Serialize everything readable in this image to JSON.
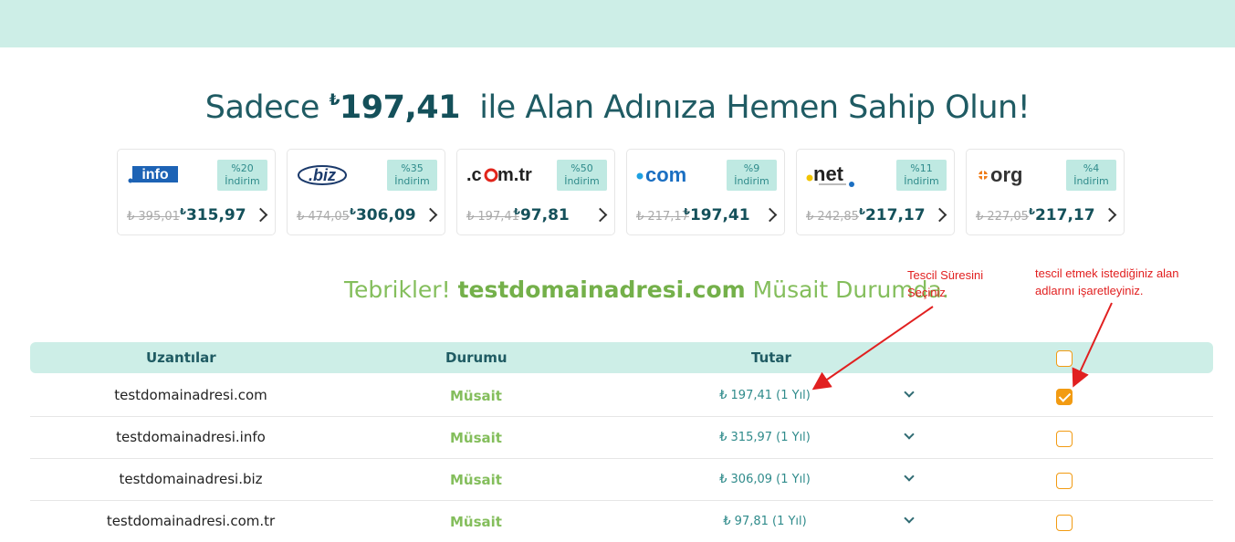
{
  "headline": {
    "prefix": "Sadece ",
    "currency": "₺",
    "price": "197,41",
    "suffix": "  ile Alan Adınıza Hemen Sahip Olun!"
  },
  "cards": [
    {
      "ext": ".info",
      "discount": "%20",
      "discount_label": "İndirim",
      "old_price": "₺ 395,01",
      "new_price": "315,97",
      "currency": "₺",
      "logo_icon": "info-logo-icon"
    },
    {
      "ext": ".biz",
      "discount": "%35",
      "discount_label": "İndirim",
      "old_price": "₺ 474,05",
      "new_price": "306,09",
      "currency": "₺",
      "logo_icon": "biz-logo-icon"
    },
    {
      "ext": ".com.tr",
      "discount": "%50",
      "discount_label": "İndirim",
      "old_price": "₺ 197,41",
      "new_price": "97,81",
      "currency": "₺",
      "logo_icon": "comtr-logo-icon"
    },
    {
      "ext": ".com",
      "discount": "%9",
      "discount_label": "İndirim",
      "old_price": "₺ 217,17",
      "new_price": "197,41",
      "currency": "₺",
      "logo_icon": "com-logo-icon"
    },
    {
      "ext": ".net",
      "discount": "%11",
      "discount_label": "İndirim",
      "old_price": "₺ 242,85",
      "new_price": "217,17",
      "currency": "₺",
      "logo_icon": "net-logo-icon"
    },
    {
      "ext": ".org",
      "discount": "%4",
      "discount_label": "İndirim",
      "old_price": "₺ 227,05",
      "new_price": "217,17",
      "currency": "₺",
      "logo_icon": "org-logo-icon"
    }
  ],
  "congrats": {
    "prefix": "Tebrikler! ",
    "domain": "testdomainadresi.com",
    "suffix": " Müsait Durumda."
  },
  "annotations": {
    "period_line1": "Tescil Süresini",
    "period_line2": "Seçiniz",
    "check_line1": "tescil etmek istediğiniz alan",
    "check_line2": "adlarını işaretleyiniz.",
    "color": "#e12020"
  },
  "table": {
    "headers": {
      "ext": "Uzantılar",
      "status": "Durumu",
      "price": "Tutar"
    },
    "rows": [
      {
        "domain": "testdomainadresi.com",
        "status": "Müsait",
        "price": "₺ 197,41 (1 Yıl)",
        "checked": true
      },
      {
        "domain": "testdomainadresi.info",
        "status": "Müsait",
        "price": "₺ 315,97 (1 Yıl)",
        "checked": false
      },
      {
        "domain": "testdomainadresi.biz",
        "status": "Müsait",
        "price": "₺ 306,09 (1 Yıl)",
        "checked": false
      },
      {
        "domain": "testdomainadresi.com.tr",
        "status": "Müsait",
        "price": "₺ 97,81 (1 Yıl)",
        "checked": false
      }
    ]
  },
  "colors": {
    "accent_teal": "#cdeee7",
    "brand_dark": "#14505a",
    "available_green": "#84be5c",
    "checkbox_orange": "#f29b12"
  }
}
